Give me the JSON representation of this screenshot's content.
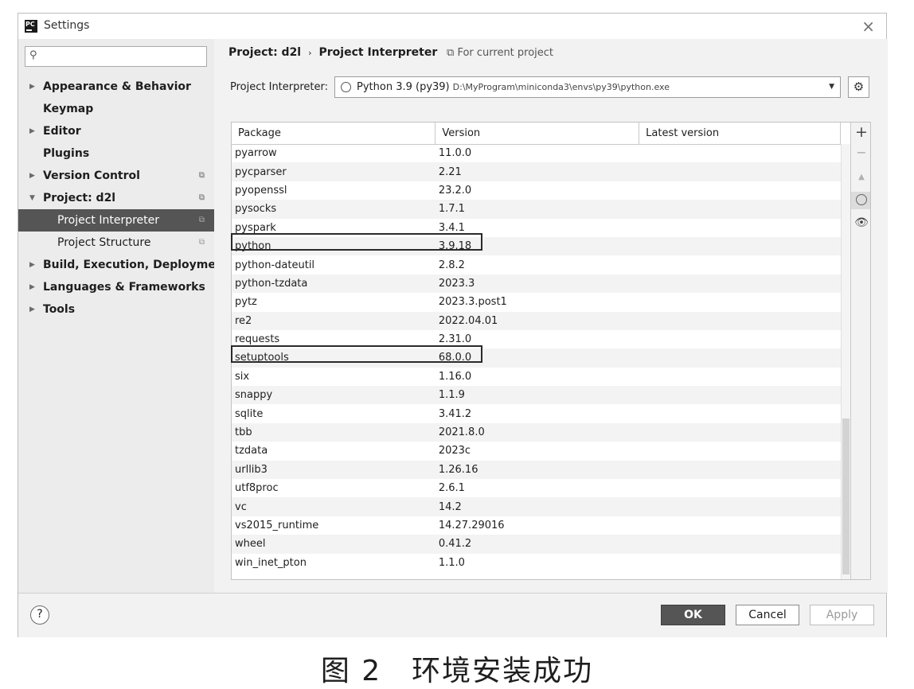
{
  "window": {
    "title": "Settings",
    "close": "×"
  },
  "search": {
    "value": "",
    "placeholder": ""
  },
  "sidebar": {
    "items": [
      {
        "label": "Appearance & Behavior",
        "expandable": true,
        "arrow": "▶"
      },
      {
        "label": "Keymap"
      },
      {
        "label": "Editor",
        "expandable": true,
        "arrow": "▶"
      },
      {
        "label": "Plugins"
      },
      {
        "label": "Version Control",
        "expandable": true,
        "arrow": "▶"
      },
      {
        "label": "Project: d2l",
        "expandable": true,
        "arrow": "▼"
      },
      {
        "label": "Project Interpreter",
        "selected": true
      },
      {
        "label": "Project Structure"
      },
      {
        "label": "Build, Execution, Deployment",
        "expandable": true,
        "arrow": "▶"
      },
      {
        "label": "Languages & Frameworks",
        "expandable": true,
        "arrow": "▶"
      },
      {
        "label": "Tools",
        "expandable": true,
        "arrow": "▶"
      }
    ]
  },
  "breadcrumb": {
    "project": "Project: d2l",
    "separator": "›",
    "page": "Project Interpreter"
  },
  "for_current": "For current project",
  "interpreter": {
    "label": "Project Interpreter:",
    "name": "Python 3.9 (py39)",
    "path": "D:\\MyProgram\\miniconda3\\envs\\py39\\python.exe"
  },
  "table": {
    "headers": [
      "Package",
      "Version",
      "Latest version"
    ],
    "rows": [
      [
        "pyarrow",
        "11.0.0"
      ],
      [
        "pycparser",
        "2.21"
      ],
      [
        "pyopenssl",
        "23.2.0"
      ],
      [
        "pysocks",
        "1.7.1"
      ],
      [
        "pyspark",
        "3.4.1"
      ],
      [
        "python",
        "3.9.18"
      ],
      [
        "python-dateutil",
        "2.8.2"
      ],
      [
        "python-tzdata",
        "2023.3"
      ],
      [
        "pytz",
        "2023.3.post1"
      ],
      [
        "re2",
        "2022.04.01"
      ],
      [
        "requests",
        "2.31.0"
      ],
      [
        "setuptools",
        "68.0.0"
      ],
      [
        "six",
        "1.16.0"
      ],
      [
        "snappy",
        "1.1.9"
      ],
      [
        "sqlite",
        "3.41.2"
      ],
      [
        "tbb",
        "2021.8.0"
      ],
      [
        "tzdata",
        "2023c"
      ],
      [
        "urllib3",
        "1.26.16"
      ],
      [
        "utf8proc",
        "2.6.1"
      ],
      [
        "vc",
        "14.2"
      ],
      [
        "vs2015_runtime",
        "14.27.29016"
      ],
      [
        "wheel",
        "0.41.2"
      ],
      [
        "win_inet_pton",
        "1.1.0"
      ]
    ]
  },
  "tools": {
    "add": "+",
    "remove": "−",
    "upgrade": "▲",
    "eye": "👁"
  },
  "buttons": {
    "help": "?",
    "ok": "OK",
    "cancel": "Cancel",
    "apply": "Apply"
  },
  "caption": "图 2　环境安装成功"
}
